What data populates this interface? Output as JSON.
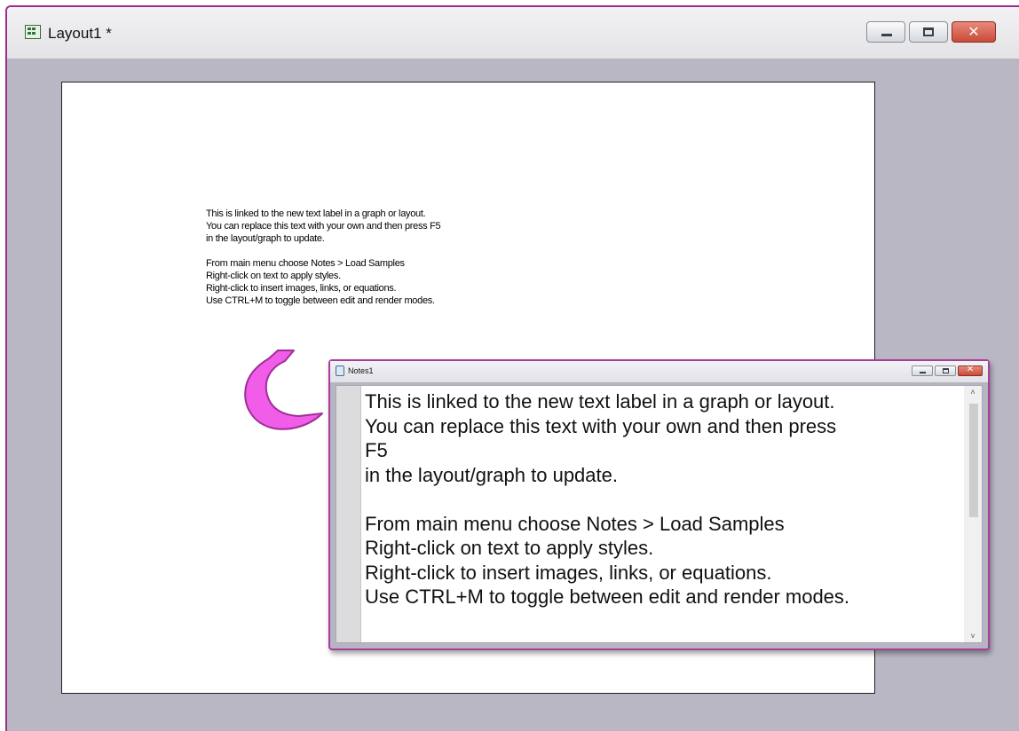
{
  "layout_window": {
    "title": "Layout1 *",
    "icon": "layout-window-icon",
    "controls": {
      "minimize_icon": "minimize-icon",
      "maximize_icon": "maximize-icon",
      "close_icon": "close-icon",
      "close_glyph": "✕"
    }
  },
  "layout_page": {
    "text_lines": [
      "This is linked to the new text label in a graph or layout.",
      "You can replace this text with your own and then press F5",
      "in the layout/graph to update.",
      "",
      "From main menu choose Notes > Load Samples",
      "Right-click on text to apply styles.",
      "Right-click to insert images, links, or equations.",
      "Use CTRL+M to toggle between edit and render modes."
    ]
  },
  "callout": {
    "icon": "curved-arrow-icon",
    "color": "#f15ce8"
  },
  "notes_window": {
    "title": "Notes1",
    "icon": "notes-window-icon",
    "controls": {
      "close_glyph": "✕"
    },
    "scroll_up": "˄",
    "scroll_down": "˅",
    "text_lines": [
      "This is linked to the new text label in a graph or layout.",
      "You can replace this text with your own and then press",
      "F5",
      "in the layout/graph to update.",
      "",
      "From main menu choose Notes > Load Samples",
      "Right-click on text to apply styles.",
      "Right-click to insert images, links, or equations.",
      "Use CTRL+M to toggle between edit and render modes."
    ]
  },
  "colors": {
    "window_border": "#a12d8b",
    "workspace": "#b9b7c3",
    "page": "#ffffff"
  }
}
